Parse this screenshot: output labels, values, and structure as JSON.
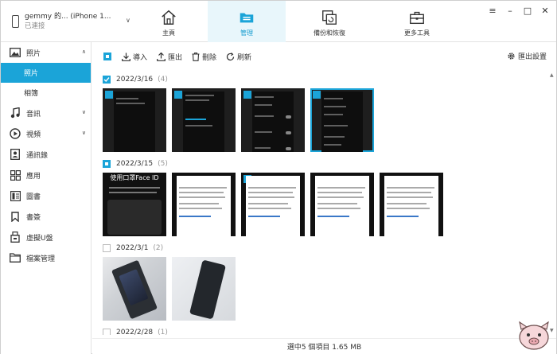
{
  "device": {
    "name": "gemmy 的... (iPhone 1...",
    "status": "已連接"
  },
  "window_controls": [
    "≡",
    "–",
    "□",
    "✕"
  ],
  "nav_tabs": [
    {
      "label": "主頁",
      "icon": "home-icon"
    },
    {
      "label": "管理",
      "icon": "manage-icon"
    },
    {
      "label": "備份和恢復",
      "icon": "backup-restore-icon"
    },
    {
      "label": "更多工具",
      "icon": "toolbox-icon"
    }
  ],
  "sidebar": {
    "items": [
      {
        "label": "照片",
        "icon": "photo-icon",
        "expanded": true,
        "children": [
          "照片",
          "相簿"
        ]
      },
      {
        "label": "音訊",
        "icon": "music-icon",
        "expanded": false
      },
      {
        "label": "視頻",
        "icon": "video-icon",
        "expanded": false
      },
      {
        "label": "通訊錄",
        "icon": "contacts-icon"
      },
      {
        "label": "應用",
        "icon": "apps-icon"
      },
      {
        "label": "圖書",
        "icon": "book-icon"
      },
      {
        "label": "書簽",
        "icon": "bookmark-icon"
      },
      {
        "label": "虛擬U盤",
        "icon": "usb-icon"
      },
      {
        "label": "檔案管理",
        "icon": "folder-icon"
      }
    ]
  },
  "toolbar": {
    "import": "導入",
    "export": "匯出",
    "delete": "刪除",
    "refresh": "刷新",
    "export_settings": "匯出設置"
  },
  "groups": [
    {
      "date": "2022/3/16",
      "count": "(4)",
      "state": "full",
      "thumbs": 4
    },
    {
      "date": "2022/3/15",
      "count": "(5)",
      "state": "part",
      "thumbs": 5
    },
    {
      "date": "2022/3/1",
      "count": "(2)",
      "state": "none",
      "thumbs": 2
    },
    {
      "date": "2022/2/28",
      "count": "(1)",
      "state": "none",
      "thumbs": 0
    }
  ],
  "thumb_text": {
    "faceid_title": "使用口罩Face ID"
  },
  "status_text": "選中5 個項目 1.65 MB",
  "colors": {
    "accent": "#1ba4d8",
    "active_tab_bg": "#e8f6fb"
  }
}
